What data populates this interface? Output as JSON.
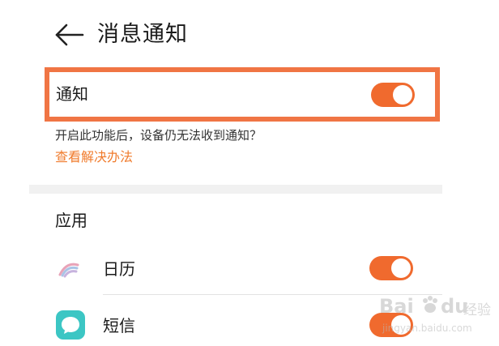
{
  "header": {
    "title": "消息通知",
    "back_icon": "arrow-left-icon"
  },
  "notification_row": {
    "label": "通知",
    "enabled": true
  },
  "hint": {
    "text": "开启此功能后，设备仍无法收到通知？",
    "link_label": "查看解决办法"
  },
  "apps_section": {
    "title": "应用",
    "items": [
      {
        "name": "日历",
        "icon": "calendar-rainbow-icon",
        "enabled": true
      },
      {
        "name": "短信",
        "icon": "sms-bubble-icon",
        "enabled": true
      }
    ]
  },
  "watermark": {
    "brand": "Bai",
    "brand_suffix": "du",
    "cn_text": "经验",
    "url": "jingyan.baidu.com"
  },
  "colors": {
    "accent": "#f07544",
    "toggle_on": "#f06a2e",
    "link": "#f07b2c",
    "sms_icon": "#3cc6c4",
    "highlight_border": "#f07544"
  }
}
